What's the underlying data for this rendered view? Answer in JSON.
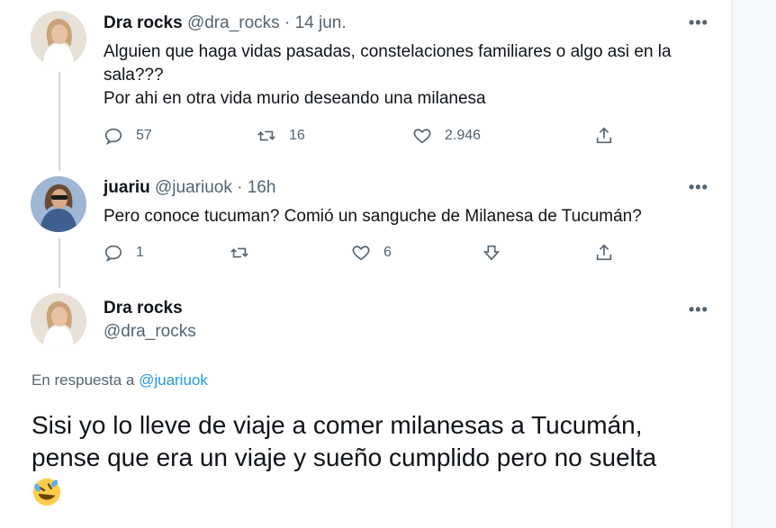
{
  "tweets": [
    {
      "name": "Dra rocks",
      "handle": "@dra_rocks",
      "sep": " · ",
      "time": "14 jun.",
      "lines": [
        "Alguien que haga vidas pasadas, constelaciones familiares o algo asi en la",
        "sala???",
        "Por ahi en otra vida murio deseando una milanesa"
      ],
      "replies": "57",
      "retweets": "16",
      "likes": "2.946"
    },
    {
      "name": "juariu",
      "handle": "@juariuok",
      "sep": " · ",
      "time": "16h",
      "lines": [
        "Pero conoce tucuman? Comió un sanguche de Milanesa de Tucumán?"
      ],
      "replies": "1",
      "retweets": "",
      "likes": "6"
    }
  ],
  "main": {
    "name": "Dra rocks",
    "handle": "@dra_rocks",
    "reply_prefix": "En respuesta a ",
    "reply_handle": "@juariuok",
    "text_line1": "Sisi yo lo lleve de viaje a comer milanesas a Tucumán,",
    "text_line2": "pense que era un viaje y sueño cumplido pero no suelta"
  },
  "more_label": "•••",
  "icons": {
    "reply": "reply-icon",
    "retweet": "retweet-icon",
    "like": "heart-icon",
    "share": "share-icon",
    "react": "react-icon",
    "emoji": "rofl-emoji-icon"
  },
  "colors": {
    "accent": "#1d9bf0",
    "muted": "#536471",
    "line": "#cfd9de"
  }
}
